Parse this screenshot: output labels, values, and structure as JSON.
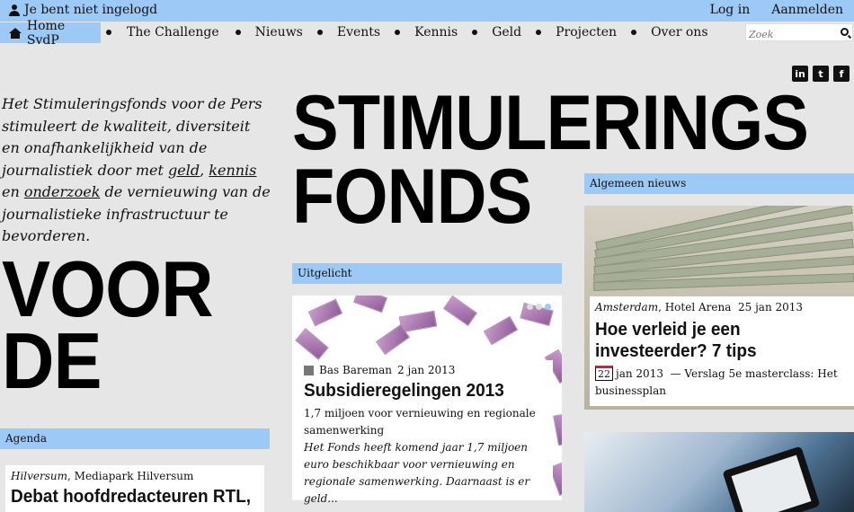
{
  "topbar": {
    "login_status": "Je bent niet ingelogd",
    "login": "Log in",
    "register": "Aanmelden"
  },
  "nav": {
    "home": "Home SvdP",
    "items": [
      "The Challenge",
      "Nieuws",
      "Events",
      "Kennis",
      "Geld",
      "Projecten",
      "Over ons"
    ]
  },
  "search": {
    "placeholder": "Zoek"
  },
  "social": [
    "in",
    "t",
    "f"
  ],
  "intro": {
    "before": "Het Stimuleringsfonds voor de Pers stimuleert de kwaliteit, diversiteit en onafhankelijkheid van de journalistiek door met ",
    "link1": "geld",
    "sep1": ", ",
    "link2": "kennis",
    "sep2": " en ",
    "link3": "onderzoek",
    "after": " de vernieuwing van de journalistieke infrastructuur te bevorderen."
  },
  "logo": {
    "line1": "STIMULERINGS",
    "line2": "FONDS",
    "line3": "VOOR",
    "line4": "DE"
  },
  "uitgelicht": {
    "section": "Uitgelicht",
    "author": "Bas Bareman",
    "date": "2 jan 2013",
    "headline": "Subsidieregelingen 2013",
    "subtitle": "1,7 miljoen voor vernieuwing en regionale samenwerking",
    "teaser": "Het Fonds heeft komend jaar 1,7 miljoen euro beschikbaar voor vernieuwing en regionale samenwerking. Daarnaast is er geld..."
  },
  "nieuws": {
    "section": "Algemeen nieuws",
    "city": "Amsterdam",
    "venue": ", Hotel Arena",
    "date": "25 jan 2013",
    "headline": "Hoe verleid je een investeerder? 7 tips",
    "cal_day": "22",
    "cal_rest": "jan 2013",
    "sub": "— Verslag 5e masterclass: Het businessplan"
  },
  "agenda": {
    "section": "Agenda",
    "city": "Hilversum",
    "venue": ", Mediapark Hilversum",
    "headline": "Debat hoofdredacteuren RTL,"
  },
  "colors": {
    "accent": "#9cc9f5",
    "background": "#e6e6e6"
  }
}
